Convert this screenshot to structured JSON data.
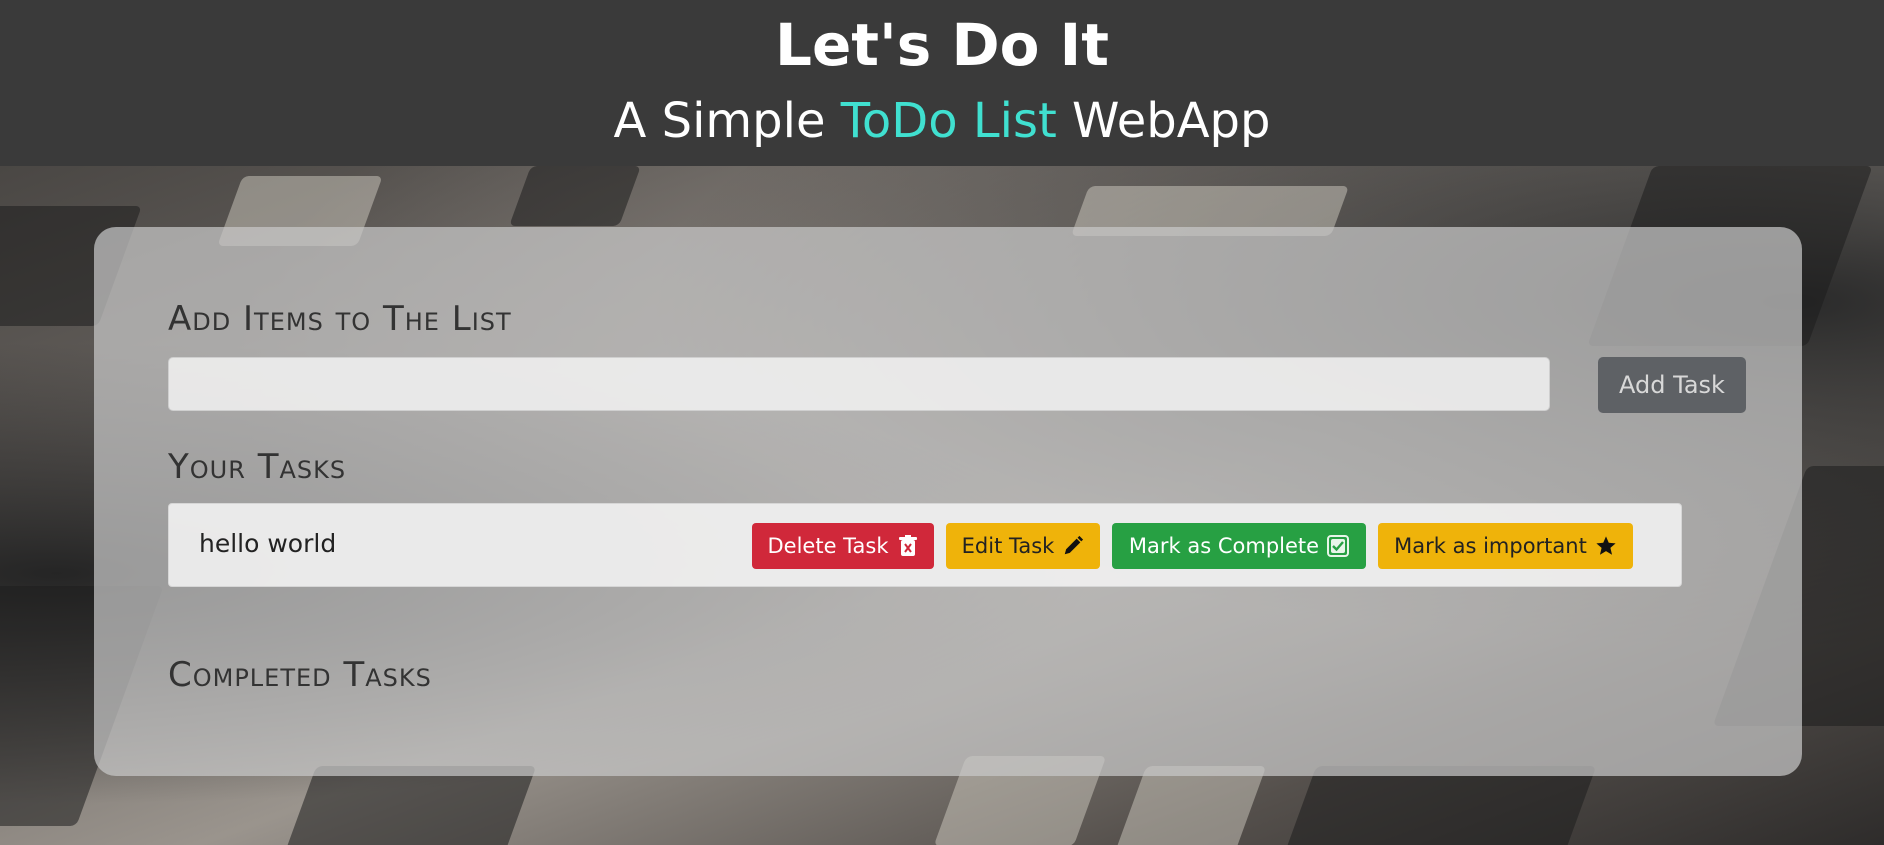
{
  "header": {
    "title": "Let's Do It",
    "subtitle_prefix": "A Simple ",
    "subtitle_accent": "ToDo List",
    "subtitle_suffix": " WebApp",
    "accent_color": "#40e0d0"
  },
  "add_section": {
    "heading": "Add Items to The List",
    "input_value": "",
    "add_button_label": "Add Task"
  },
  "tasks_section": {
    "heading": "Your Tasks",
    "tasks": [
      {
        "text": "hello world",
        "delete_label": "Delete Task",
        "edit_label": "Edit Task",
        "complete_label": "Mark as Complete",
        "important_label": "Mark as important"
      }
    ]
  },
  "completed_section": {
    "heading": "Completed Tasks"
  },
  "colors": {
    "delete": "#d0283a",
    "edit": "#efb30a",
    "complete": "#27a043",
    "important": "#efb30a",
    "header_bg": "#3a3a3a"
  },
  "icons": {
    "delete": "trash-x-icon",
    "edit": "pencil-icon",
    "complete": "check-square-icon",
    "important": "star-icon"
  }
}
